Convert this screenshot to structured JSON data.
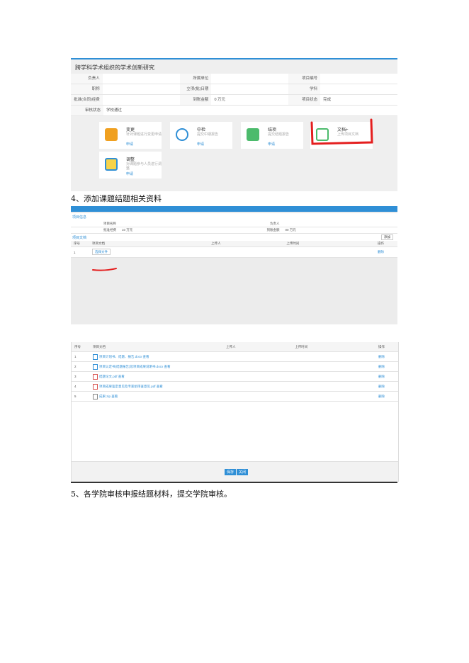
{
  "caption1": "4、添加课题结题相关资料",
  "caption2": "5、各学院审核申报结题材料，提交学院审核。",
  "shot1": {
    "title": "跨学科学术组织的学术创新研究",
    "rows": [
      [
        "负责人",
        "",
        "所属单位",
        "",
        "项目编号",
        ""
      ],
      [
        "职称",
        "",
        "立项(批)日期",
        "",
        "学科",
        ""
      ],
      [
        "批准(合同)经费",
        "",
        "到账金额",
        "0 万元",
        "项目状态",
        "完成"
      ],
      [
        "审核状态",
        "学校通过",
        "",
        "",
        "",
        ""
      ]
    ],
    "cards": [
      {
        "title": "变更",
        "desc": "针对课题进行变更申请",
        "link": "申请"
      },
      {
        "title": "中检",
        "desc": "提交中期报告",
        "link": "申请"
      },
      {
        "title": "结项",
        "desc": "提交结题报告",
        "link": "申请"
      },
      {
        "title": "文档+",
        "desc": "上传项目文档",
        "link": ""
      },
      {
        "title": "调整",
        "desc": "对课题参与人员进行调整",
        "link": "申请"
      }
    ]
  },
  "shot2": {
    "section1": "项目信息",
    "section2": "项目文档",
    "add_label": "添加",
    "fields": [
      [
        "项目名称",
        "",
        "负责人",
        ""
      ],
      [
        "批准经费",
        "10 万元",
        "到账金额",
        "00 万元"
      ]
    ],
    "headers": [
      "序号",
      "项目文档",
      "上传人",
      "上传时间",
      "操作"
    ],
    "rows": [
      [
        "1",
        "选择文件",
        "",
        "",
        "删除"
      ]
    ]
  },
  "shot3": {
    "headers": [
      "序号",
      "项目文档",
      "上传人",
      "上传时间",
      "操作"
    ],
    "rows": [
      [
        "1",
        "项目计划书、结题、报告.docx 查看",
        "",
        "",
        "删除"
      ],
      [
        "2",
        "项目认定书(结题报告)及项目成果说明书.docx 查看",
        "",
        "",
        "删除"
      ],
      [
        "3",
        "结题论文.pdf 查看",
        "",
        "",
        "删除"
      ],
      [
        "4",
        "项目成果鉴定意见及专家组审查意见.pdf 查看",
        "",
        "",
        "删除"
      ],
      [
        "5",
        "成果.zip 查看",
        "",
        "",
        "删除"
      ]
    ],
    "save": "保存",
    "close": "关闭"
  }
}
